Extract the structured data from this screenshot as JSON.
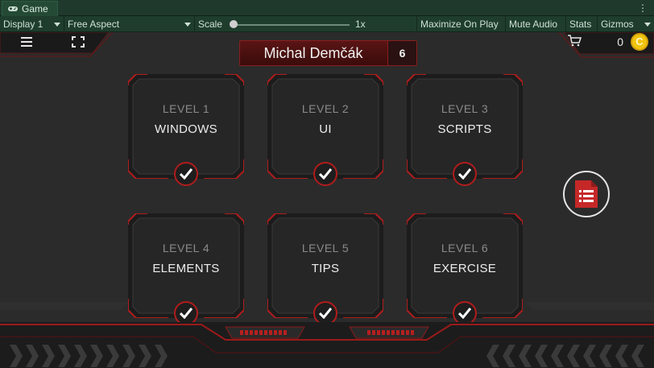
{
  "editor": {
    "tab_label": "Game",
    "display": "Display 1",
    "aspect": "Free Aspect",
    "scale_label": "Scale",
    "scale_value": "1x",
    "maximize": "Maximize On Play",
    "mute": "Mute Audio",
    "stats": "Stats",
    "gizmos": "Gizmos",
    "kebab": "⋮"
  },
  "hud": {
    "menu_icon": "hamburger-icon",
    "fullscreen_icon": "fullscreen-icon",
    "player_name": "Michal Demčák",
    "player_count": "6",
    "cart_icon": "cart-icon",
    "coins": "0",
    "coin_symbol": "C"
  },
  "levels": [
    {
      "level": "LEVEL 1",
      "title": "WINDOWS",
      "completed": true
    },
    {
      "level": "LEVEL 2",
      "title": "UI",
      "completed": true
    },
    {
      "level": "LEVEL 3",
      "title": "SCRIPTS",
      "completed": true
    },
    {
      "level": "LEVEL 4",
      "title": "ELEMENTS",
      "completed": true
    },
    {
      "level": "LEVEL 5",
      "title": "TIPS",
      "completed": true
    },
    {
      "level": "LEVEL 6",
      "title": "EXERCISE",
      "completed": true
    }
  ],
  "colors": {
    "accent_red": "#b01c1c",
    "editor_green": "#1e3d2d",
    "background": "#2b2b2b",
    "coin": "#f1c40f"
  }
}
